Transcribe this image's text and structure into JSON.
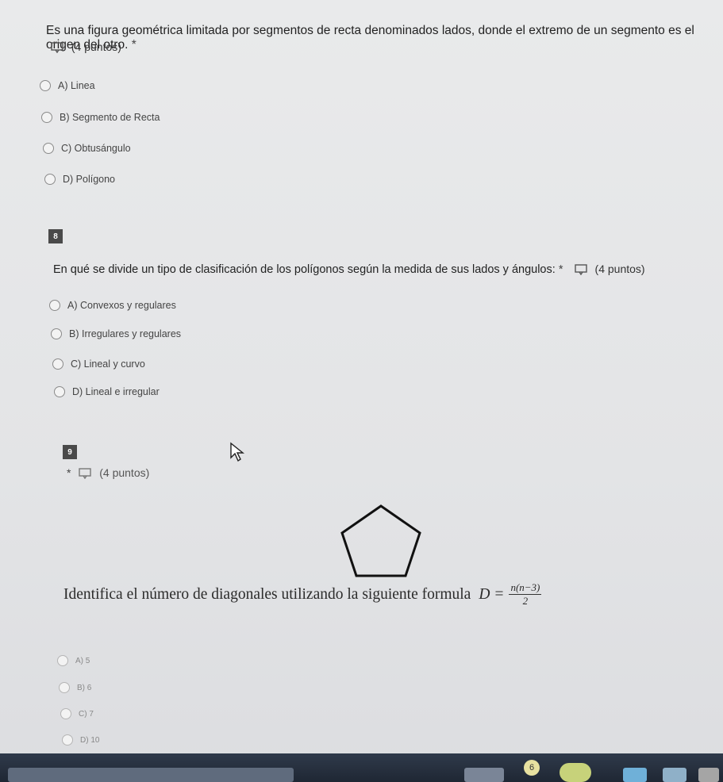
{
  "q7": {
    "text": "Es una figura geométrica limitada por segmentos de recta denominados lados, donde el extremo de un segmento es el origen del otro.",
    "required": "*",
    "points": "(4 puntos)",
    "options": [
      "A) Linea",
      "B) Segmento de Recta",
      "C) Obtusángulo",
      "D) Polígono"
    ]
  },
  "q8": {
    "number": "8",
    "text": "En qué se divide un tipo de clasificación de los polígonos según la medida de sus lados y ángulos:",
    "required": "*",
    "points": "(4 puntos)",
    "options": [
      "A) Convexos y regulares",
      "B) Irregulares y regulares",
      "C) Lineal y curvo",
      "D) Lineal e irregular"
    ]
  },
  "q9": {
    "number": "9",
    "required": "*",
    "points": "(4 puntos)",
    "image_text": "Identifica el número de diagonales utilizando la siguiente formula",
    "formula_lhs": "D =",
    "formula_num": "n(n−3)",
    "formula_den": "2",
    "options": [
      "A) 5",
      "B) 6",
      "C) 7",
      "D) 10"
    ]
  },
  "taskbar": {
    "badge": "6"
  }
}
